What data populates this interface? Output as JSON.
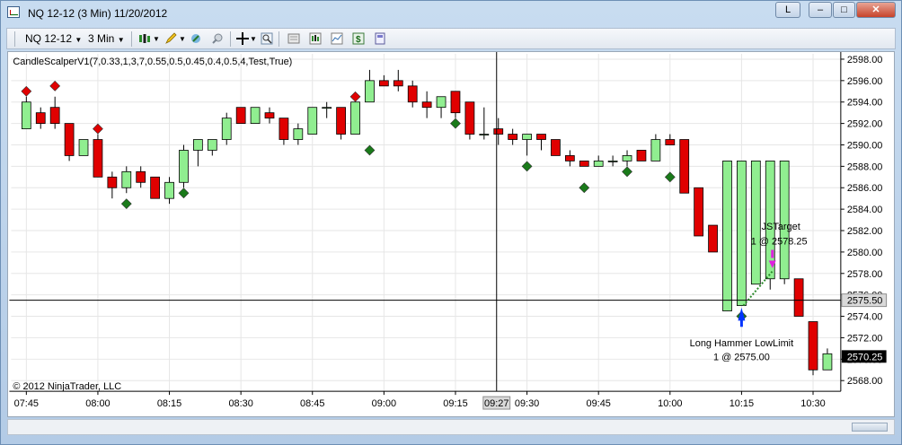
{
  "window": {
    "title": "NQ 12-12 (3 Min)  11/20/2012",
    "link_button": "L"
  },
  "toolbar": {
    "instrument": "NQ 12-12",
    "interval": "3 Min",
    "icons": [
      "candle-style-icon",
      "pencil-draw-icon",
      "strategy-icon",
      "properties-icon",
      "crosshair-icon",
      "zoom-icon",
      "data-box-icon",
      "chart-trader-icon",
      "indicators-icon",
      "strategies-icon",
      "colors-icon"
    ]
  },
  "chart": {
    "indicator_label": "CandleScalperV1(7,0.33,1,3,7,0.55,0.5,0.45,0.4,0.5,4,Test,True)",
    "copyright": "© 2012 NinjaTrader, LLC",
    "y_ticks": [
      "2598.00",
      "2596.00",
      "2594.00",
      "2592.00",
      "2590.00",
      "2588.00",
      "2586.00",
      "2584.00",
      "2582.00",
      "2580.00",
      "2578.00",
      "2576.00",
      "2574.00",
      "2572.00",
      "2570.00",
      "2568.00"
    ],
    "x_ticks": [
      "07:45",
      "08:00",
      "08:15",
      "08:30",
      "08:45",
      "09:00",
      "09:15",
      "09:30",
      "09:45",
      "10:00",
      "10:15",
      "10:30"
    ],
    "crosshair_time": "09:27",
    "crosshair_price": "2575.50",
    "last_price": "2570.25",
    "annotations": {
      "target_name": "JSTarget",
      "target_fill": "1 @ 2578.25",
      "entry_name": "Long Hammer LowLimit",
      "entry_fill": "1 @ 2575.00"
    },
    "colors": {
      "up": "#90ee90",
      "down": "#e00000",
      "signal_up": "#1a7a1a",
      "signal_down": "#e00000"
    }
  },
  "chart_data": {
    "type": "candlestick",
    "ylim": [
      2567,
      2598.5
    ],
    "candles": [
      {
        "t": "07:45",
        "o": 2591.5,
        "h": 2594.5,
        "l": 2591.5,
        "c": 2594.0
      },
      {
        "t": "07:48",
        "o": 2593.0,
        "h": 2593.5,
        "l": 2591.5,
        "c": 2592.0
      },
      {
        "t": "07:51",
        "o": 2593.5,
        "h": 2594.5,
        "l": 2591.5,
        "c": 2592.0
      },
      {
        "t": "07:54",
        "o": 2592.0,
        "h": 2592.0,
        "l": 2588.5,
        "c": 2589.0
      },
      {
        "t": "07:57",
        "o": 2589.0,
        "h": 2590.5,
        "l": 2589.0,
        "c": 2590.5
      },
      {
        "t": "08:00",
        "o": 2590.5,
        "h": 2591.0,
        "l": 2587.0,
        "c": 2587.0
      },
      {
        "t": "08:03",
        "o": 2587.0,
        "h": 2587.5,
        "l": 2585.0,
        "c": 2586.0
      },
      {
        "t": "08:06",
        "o": 2586.0,
        "h": 2588.0,
        "l": 2585.5,
        "c": 2587.5
      },
      {
        "t": "08:09",
        "o": 2587.5,
        "h": 2588.0,
        "l": 2586.0,
        "c": 2586.5
      },
      {
        "t": "08:12",
        "o": 2587.0,
        "h": 2587.0,
        "l": 2585.0,
        "c": 2585.0
      },
      {
        "t": "08:15",
        "o": 2585.0,
        "h": 2587.0,
        "l": 2584.5,
        "c": 2586.5
      },
      {
        "t": "08:18",
        "o": 2586.5,
        "h": 2590.0,
        "l": 2586.0,
        "c": 2589.5
      },
      {
        "t": "08:21",
        "o": 2589.5,
        "h": 2590.5,
        "l": 2588.0,
        "c": 2590.5
      },
      {
        "t": "08:24",
        "o": 2589.5,
        "h": 2590.5,
        "l": 2589.0,
        "c": 2590.5
      },
      {
        "t": "08:30",
        "o": 2590.5,
        "h": 2593.0,
        "l": 2590.0,
        "c": 2592.5
      },
      {
        "t": "08:33",
        "o": 2593.5,
        "h": 2593.5,
        "l": 2592.0,
        "c": 2592.0
      },
      {
        "t": "08:36",
        "o": 2592.0,
        "h": 2593.5,
        "l": 2592.0,
        "c": 2593.5
      },
      {
        "t": "08:39",
        "o": 2593.0,
        "h": 2593.5,
        "l": 2592.0,
        "c": 2592.5
      },
      {
        "t": "08:42",
        "o": 2592.5,
        "h": 2592.5,
        "l": 2590.0,
        "c": 2590.5
      },
      {
        "t": "08:45",
        "o": 2590.5,
        "h": 2592.0,
        "l": 2590.0,
        "c": 2591.5
      },
      {
        "t": "08:48",
        "o": 2591.0,
        "h": 2593.5,
        "l": 2591.0,
        "c": 2593.5
      },
      {
        "t": "08:51",
        "o": 2593.5,
        "h": 2594.0,
        "l": 2592.5,
        "c": 2593.5
      },
      {
        "t": "08:54",
        "o": 2593.5,
        "h": 2593.5,
        "l": 2590.5,
        "c": 2591.0
      },
      {
        "t": "08:57",
        "o": 2591.0,
        "h": 2594.0,
        "l": 2591.0,
        "c": 2594.0
      },
      {
        "t": "09:00",
        "o": 2594.0,
        "h": 2597.0,
        "l": 2594.0,
        "c": 2596.0
      },
      {
        "t": "09:03",
        "o": 2596.0,
        "h": 2596.5,
        "l": 2595.5,
        "c": 2595.5
      },
      {
        "t": "09:06",
        "o": 2596.0,
        "h": 2597.0,
        "l": 2595.0,
        "c": 2595.5
      },
      {
        "t": "09:09",
        "o": 2595.5,
        "h": 2596.0,
        "l": 2593.5,
        "c": 2594.0
      },
      {
        "t": "09:12",
        "o": 2594.0,
        "h": 2595.0,
        "l": 2592.5,
        "c": 2593.5
      },
      {
        "t": "09:15",
        "o": 2593.5,
        "h": 2594.5,
        "l": 2592.5,
        "c": 2594.5
      },
      {
        "t": "09:18",
        "o": 2595.0,
        "h": 2595.0,
        "l": 2592.5,
        "c": 2593.0
      },
      {
        "t": "09:21",
        "o": 2594.0,
        "h": 2594.0,
        "l": 2590.5,
        "c": 2591.0
      },
      {
        "t": "09:24",
        "o": 2591.0,
        "h": 2593.5,
        "l": 2590.5,
        "c": 2591.0
      },
      {
        "t": "09:27",
        "o": 2591.5,
        "h": 2592.5,
        "l": 2590.0,
        "c": 2591.0
      },
      {
        "t": "09:30",
        "o": 2591.0,
        "h": 2591.5,
        "l": 2590.0,
        "c": 2590.5
      },
      {
        "t": "09:33",
        "o": 2590.5,
        "h": 2591.0,
        "l": 2589.0,
        "c": 2591.0
      },
      {
        "t": "09:36",
        "o": 2591.0,
        "h": 2591.0,
        "l": 2589.5,
        "c": 2590.5
      },
      {
        "t": "09:39",
        "o": 2590.5,
        "h": 2590.5,
        "l": 2589.0,
        "c": 2589.0
      },
      {
        "t": "09:42",
        "o": 2589.0,
        "h": 2589.5,
        "l": 2588.0,
        "c": 2588.5
      },
      {
        "t": "09:45",
        "o": 2588.5,
        "h": 2588.5,
        "l": 2588.0,
        "c": 2588.0
      },
      {
        "t": "09:48",
        "o": 2588.0,
        "h": 2589.0,
        "l": 2588.0,
        "c": 2588.5
      },
      {
        "t": "09:51",
        "o": 2588.5,
        "h": 2589.0,
        "l": 2588.0,
        "c": 2588.5
      },
      {
        "t": "09:54",
        "o": 2588.5,
        "h": 2589.5,
        "l": 2588.0,
        "c": 2589.0
      },
      {
        "t": "09:57",
        "o": 2589.5,
        "h": 2589.5,
        "l": 2588.5,
        "c": 2588.5
      },
      {
        "t": "10:00",
        "o": 2588.5,
        "h": 2591.0,
        "l": 2588.5,
        "c": 2590.5
      },
      {
        "t": "10:03",
        "o": 2590.5,
        "h": 2591.0,
        "l": 2590.0,
        "c": 2590.0
      },
      {
        "t": "10:06",
        "o": 2590.5,
        "h": 2590.5,
        "l": 2585.5,
        "c": 2585.5
      },
      {
        "t": "10:09",
        "o": 2586.0,
        "h": 2586.0,
        "l": 2581.5,
        "c": 2581.5
      },
      {
        "t": "10:12",
        "o": 2582.5,
        "h": 2582.5,
        "l": 2580.0,
        "c": 2580.0
      },
      {
        "t": "10:15",
        "o": 2574.5,
        "h": 2588.5,
        "l": 2574.5,
        "c": 2588.5
      },
      {
        "t": "10:18",
        "o": 2575.0,
        "h": 2588.5,
        "l": 2575.0,
        "c": 2588.5
      },
      {
        "t": "10:21",
        "o": 2577.0,
        "h": 2588.5,
        "l": 2577.0,
        "c": 2588.5
      },
      {
        "t": "10:24",
        "o": 2577.5,
        "h": 2588.5,
        "l": 2576.5,
        "c": 2588.5
      },
      {
        "t": "10:27",
        "o": 2577.5,
        "h": 2588.5,
        "l": 2577.0,
        "c": 2588.5
      },
      {
        "t": "10:30",
        "o": 2577.5,
        "h": 2577.5,
        "l": 2574.0,
        "c": 2574.0
      },
      {
        "t": "10:33",
        "o": 2573.5,
        "h": 2573.5,
        "l": 2568.5,
        "c": 2569.0
      },
      {
        "t": "10:36",
        "o": 2569.0,
        "h": 2571.0,
        "l": 2569.0,
        "c": 2570.5
      }
    ],
    "signals": [
      {
        "i": 0,
        "side": "down",
        "price": 2595.0
      },
      {
        "i": 2,
        "side": "down",
        "price": 2595.5
      },
      {
        "i": 5,
        "side": "down",
        "price": 2591.5
      },
      {
        "i": 7,
        "side": "up",
        "price": 2584.5
      },
      {
        "i": 11,
        "side": "up",
        "price": 2585.5
      },
      {
        "i": 23,
        "side": "down",
        "price": 2594.5
      },
      {
        "i": 24,
        "side": "up",
        "price": 2589.5
      },
      {
        "i": 30,
        "side": "up",
        "price": 2592.0
      },
      {
        "i": 35,
        "side": "up",
        "price": 2588.0
      },
      {
        "i": 39,
        "side": "up",
        "price": 2586.0
      },
      {
        "i": 42,
        "side": "up",
        "price": 2587.5
      },
      {
        "i": 45,
        "side": "up",
        "price": 2587.0
      },
      {
        "i": 50,
        "side": "up",
        "price": 2574.0
      }
    ]
  }
}
